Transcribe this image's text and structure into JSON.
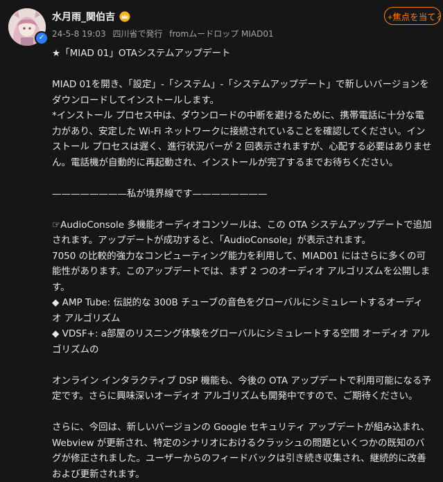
{
  "user": {
    "name": "水月雨_関伯吉",
    "verified_symbol": "✓",
    "timestamp": "24-5-8 19:03",
    "location": "四川省で発行",
    "source": "fromムードロップ MIAD01"
  },
  "follow_button": {
    "label": "+焦点を当てる"
  },
  "post": {
    "title": "★「MIAD 01」OTAシステムアップデート",
    "p1": "MIAD 01を開き、「設定」-「システム」-「システムアップデート」で新しいバージョンをダウンロードしてインストールします。",
    "p2": "*インストール プロセス中は、ダウンロードの中断を避けるために、携帯電話に十分な電力があり、安定した Wi-Fi ネットワークに接続されていることを確認してください。インストール プロセスは遅く、進行状況バーが 2 回表示されますが、心配する必要はありません。電話機が自動的に再起動され、インストールが完了するまでお待ちください。",
    "divider": "————————私が境界線です————————",
    "p3": "☞AudioConsole 多機能オーディオコンソールは、この OTA システムアップデートで追加されます。アップデートが成功すると、「AudioConsole」が表示されます。",
    "p4": "7050 の比較的強力なコンピューティング能力を利用して、MIAD01 にはさらに多くの可能性があります。このアップデートでは、まず 2 つのオーディオ アルゴリズムを公開します。",
    "p5": "◆ AMP Tube: 伝説的な 300B チューブの音色をグローバルにシミュレートするオーディオ アルゴリズム",
    "p6": "◆ VDSF+: a部屋のリスニング体験をグローバルにシミュレートする空間 オーディオ アルゴリズムの",
    "p7": "オンライン インタラクティブ DSP 機能も、今後の OTA アップデートで利用可能になる予定です。さらに興味深いオーディオ アルゴリズムも開発中ですので、ご期待ください。",
    "p8": "さらに、今回は、新しいバージョンの Google セキュリティ アップデートが組み込まれ、Webview が更新され、特定のシナリオにおけるクラッシュの問題といくつかの既知のバグが修正されました。ユーザーからのフィードバックは引き続き収集され、継続的に改善および更新されます。"
  },
  "colors": {
    "accent": "#ff8200",
    "background": "#161616",
    "verified": "#2e7df6"
  },
  "icons": {
    "avatar": "avatar-illustration",
    "crown": "crown-icon",
    "verified": "verified-icon"
  }
}
